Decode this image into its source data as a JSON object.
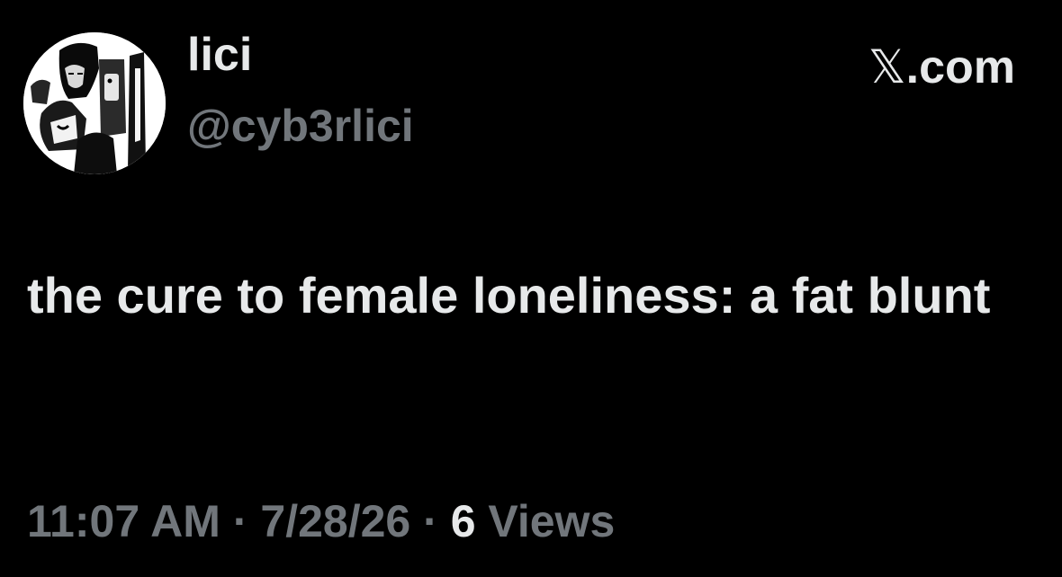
{
  "user": {
    "display_name": "lici",
    "handle": "@cyb3rlici"
  },
  "brand": {
    "logo_glyph": "𝕏",
    "domain": ".com"
  },
  "tweet": {
    "text": "the cure to female loneliness: a fat blunt"
  },
  "meta": {
    "time": "11:07 AM",
    "separator": "·",
    "date": "7/28/26",
    "views_count": "6",
    "views_label": "Views"
  },
  "colors": {
    "background": "#000000",
    "primary_text": "#e7e9ea",
    "secondary_text": "#71767b"
  },
  "icons": {
    "avatar": "profile-photo-avatar"
  }
}
